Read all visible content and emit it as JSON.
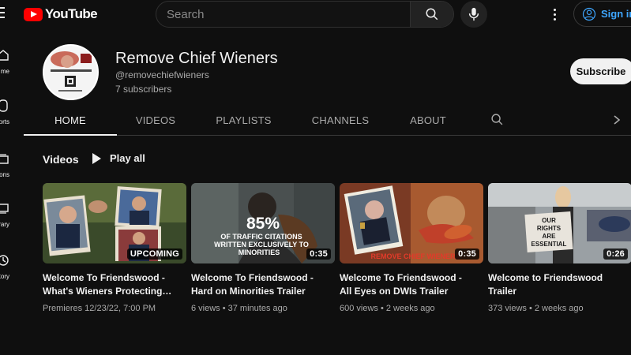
{
  "app": {
    "logo_text": "YouTube"
  },
  "search": {
    "placeholder": "Search"
  },
  "header": {
    "signin_label": "Sign in"
  },
  "guide": [
    {
      "label": "me",
      "icon": "home-icon"
    },
    {
      "label": "orts",
      "icon": "shorts-icon"
    },
    {
      "label": "iptions",
      "icon": "subscriptions-icon"
    },
    {
      "label": "rary",
      "icon": "library-icon"
    },
    {
      "label": "tory",
      "icon": "history-icon"
    }
  ],
  "channel": {
    "name": "Remove Chief Wieners",
    "handle": "@removechiefwieners",
    "subscribers": "7 subscribers",
    "subscribe_label": "Subscribe"
  },
  "tabs": [
    "HOME",
    "VIDEOS",
    "PLAYLISTS",
    "CHANNELS",
    "ABOUT"
  ],
  "active_tab": "HOME",
  "section": {
    "title": "Videos",
    "play_all_label": "Play all"
  },
  "videos": [
    {
      "title": "Welcome To Friendswood -\nWhat's Wieners Protecting…",
      "meta": "Premieres 12/23/22, 7:00 PM",
      "badge": "UPCOMING"
    },
    {
      "title": "Welcome To Friendswood -\nHard on Minorities Trailer",
      "meta": "6 views • 37 minutes ago",
      "badge": "0:35"
    },
    {
      "title": "Welcome To Friendswood -\nAll Eyes on DWIs Trailer",
      "meta": "600 views • 2 weeks ago",
      "badge": "0:35"
    },
    {
      "title": "Welcome to Friendswood\nTrailer",
      "meta": "373 views • 2 weeks ago",
      "badge": "0:26"
    }
  ],
  "thumb_text": {
    "stat": "85%",
    "stat_caption_1": "OF TRAFFIC CITATIONS",
    "stat_caption_2": "WRITTEN EXCLUSIVELY TO",
    "stat_caption_3": "MINORITIES",
    "brand": "REMOVE CHIEF WIENERS",
    "sign_1": "OUR",
    "sign_2": "RIGHTS",
    "sign_3": "ARE",
    "sign_4": "ESSENTIAL"
  },
  "colors": {
    "background": "#0f0f0f",
    "brand_red": "#ff0000",
    "link_blue": "#3ea6ff"
  }
}
